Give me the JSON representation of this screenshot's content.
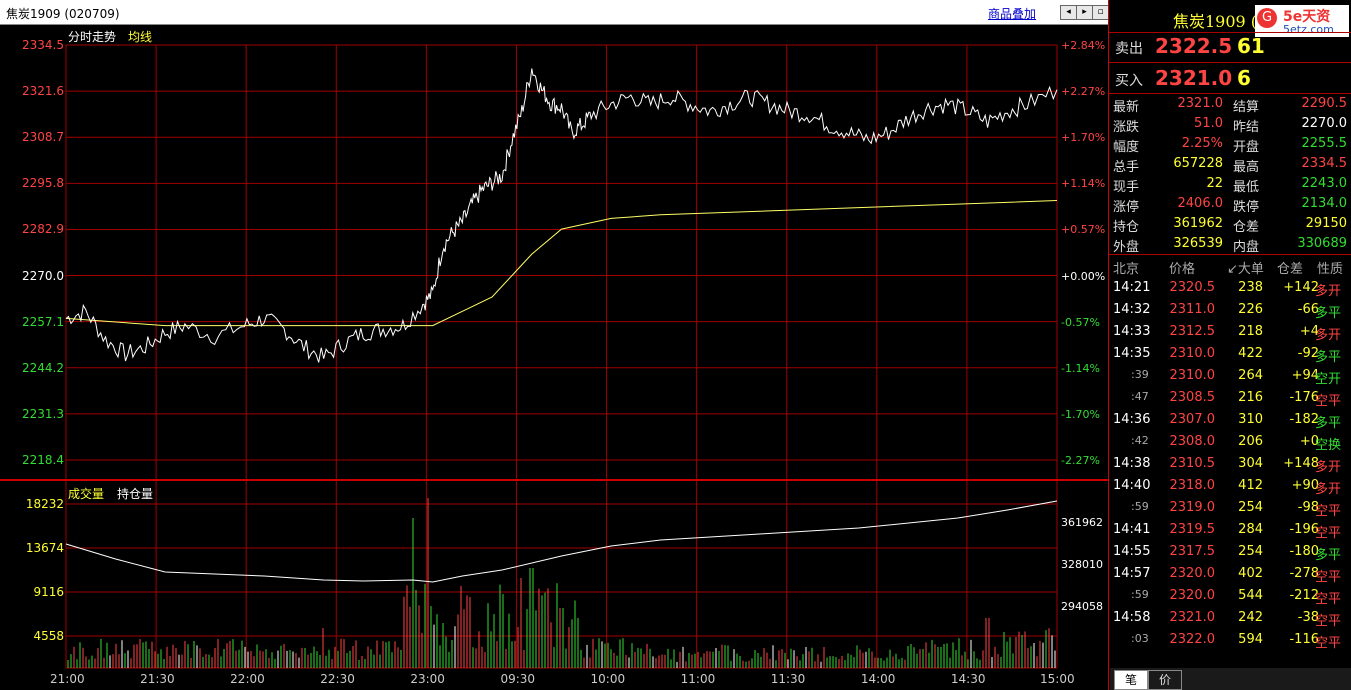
{
  "window": {
    "title": "焦炭1909 (020709)",
    "overlay_link": "商品叠加"
  },
  "price_chart": {
    "tab_label": "分时走势",
    "avg_label": "均线",
    "y_ticks_left": [
      "2334.5",
      "2321.6",
      "2308.7",
      "2295.8",
      "2282.9",
      "2270.0",
      "2257.1",
      "2244.2",
      "2231.3",
      "2218.4"
    ],
    "y_ticks_right": [
      "+2.84%",
      "+2.27%",
      "+1.70%",
      "+1.14%",
      "+0.57%",
      "+0.00%",
      "-0.57%",
      "-1.14%",
      "-1.70%",
      "-2.27%"
    ],
    "colors": {
      "up": "#ff4444",
      "flat": "#ffffff",
      "down": "#33dd33",
      "grid": "#a00000",
      "price": "#ffffff",
      "average": "#ffff66"
    }
  },
  "volume_chart": {
    "label_volume": "成交量",
    "label_oi": "持仓量",
    "y_ticks_left": [
      "18232",
      "13674",
      "9116",
      "4558"
    ],
    "y_ticks_right": [
      "361962",
      "328010",
      "294058"
    ]
  },
  "time_axis": [
    "21:00",
    "21:30",
    "22:00",
    "22:30",
    "23:00",
    "09:30",
    "10:00",
    "11:00",
    "11:30",
    "14:00",
    "14:30",
    "15:00"
  ],
  "chart_data": [
    {
      "type": "line",
      "title": "分时走势",
      "ylim": [
        2218.4,
        2334.5
      ],
      "series": [
        {
          "name": "价格",
          "points": [
            [
              0,
              2258
            ],
            [
              0.02,
              2260
            ],
            [
              0.04,
              2252
            ],
            [
              0.06,
              2248
            ],
            [
              0.08,
              2250
            ],
            [
              0.1,
              2254
            ],
            [
              0.12,
              2256
            ],
            [
              0.15,
              2253
            ],
            [
              0.18,
              2256
            ],
            [
              0.2,
              2258
            ],
            [
              0.22,
              2255
            ],
            [
              0.24,
              2250
            ],
            [
              0.26,
              2247
            ],
            [
              0.28,
              2251
            ],
            [
              0.3,
              2254
            ],
            [
              0.32,
              2255
            ],
            [
              0.34,
              2256
            ],
            [
              0.36,
              2262
            ],
            [
              0.37,
              2265
            ],
            [
              0.38,
              2278
            ],
            [
              0.39,
              2282
            ],
            [
              0.4,
              2285
            ],
            [
              0.41,
              2290
            ],
            [
              0.42,
              2294
            ],
            [
              0.43,
              2296
            ],
            [
              0.44,
              2298
            ],
            [
              0.45,
              2308
            ],
            [
              0.46,
              2316
            ],
            [
              0.47,
              2328
            ],
            [
              0.48,
              2322
            ],
            [
              0.49,
              2318
            ],
            [
              0.5,
              2317
            ],
            [
              0.51,
              2310
            ],
            [
              0.52,
              2312
            ],
            [
              0.53,
              2315
            ],
            [
              0.55,
              2318
            ],
            [
              0.57,
              2320
            ],
            [
              0.59,
              2318
            ],
            [
              0.61,
              2320
            ],
            [
              0.63,
              2318
            ],
            [
              0.65,
              2316
            ],
            [
              0.67,
              2318
            ],
            [
              0.69,
              2320
            ],
            [
              0.71,
              2318
            ],
            [
              0.73,
              2316
            ],
            [
              0.75,
              2315
            ],
            [
              0.77,
              2312
            ],
            [
              0.79,
              2310
            ],
            [
              0.81,
              2308
            ],
            [
              0.83,
              2310
            ],
            [
              0.85,
              2314
            ],
            [
              0.87,
              2317
            ],
            [
              0.89,
              2318
            ],
            [
              0.91,
              2316
            ],
            [
              0.93,
              2313
            ],
            [
              0.95,
              2316
            ],
            [
              0.97,
              2318
            ],
            [
              1.0,
              2322
            ]
          ]
        },
        {
          "name": "均线",
          "points": [
            [
              0,
              2258
            ],
            [
              0.1,
              2256
            ],
            [
              0.2,
              2256
            ],
            [
              0.3,
              2256
            ],
            [
              0.37,
              2256
            ],
            [
              0.4,
              2260
            ],
            [
              0.43,
              2264
            ],
            [
              0.45,
              2270
            ],
            [
              0.47,
              2276
            ],
            [
              0.5,
              2283
            ],
            [
              0.55,
              2286
            ],
            [
              0.6,
              2287
            ],
            [
              0.7,
              2288
            ],
            [
              0.8,
              2289
            ],
            [
              0.9,
              2290
            ],
            [
              1.0,
              2291
            ]
          ]
        }
      ]
    },
    {
      "type": "bar",
      "title": "成交量",
      "ylim": [
        0,
        18232
      ]
    }
  ],
  "quote": {
    "symbol_title": "焦炭1909 (",
    "brand": "5e天资",
    "brand_sub": "5etz.com",
    "sell_label": "卖出",
    "sell_price": "2322.5",
    "sell_vol": "61",
    "buy_label": "买入",
    "buy_price": "2321.0",
    "buy_vol": "6",
    "stats": [
      {
        "l1": "最新",
        "v1": "2321.0",
        "c1": "red",
        "l2": "结算",
        "v2": "2290.5",
        "c2": "red"
      },
      {
        "l1": "涨跌",
        "v1": "51.0",
        "c1": "red",
        "l2": "昨结",
        "v2": "2270.0",
        "c2": "white"
      },
      {
        "l1": "幅度",
        "v1": "2.25%",
        "c1": "red",
        "l2": "开盘",
        "v2": "2255.5",
        "c2": "green"
      },
      {
        "l1": "总手",
        "v1": "657228",
        "c1": "yellow",
        "l2": "最高",
        "v2": "2334.5",
        "c2": "red"
      },
      {
        "l1": "现手",
        "v1": "22",
        "c1": "yellow",
        "l2": "最低",
        "v2": "2243.0",
        "c2": "green"
      },
      {
        "l1": "涨停",
        "v1": "2406.0",
        "c1": "red",
        "l2": "跌停",
        "v2": "2134.0",
        "c2": "green"
      },
      {
        "l1": "持仓",
        "v1": "361962",
        "c1": "yellow",
        "l2": "仓差",
        "v2": "29150",
        "c2": "yellow"
      },
      {
        "l1": "外盘",
        "v1": "326539",
        "c1": "yellow",
        "l2": "内盘",
        "v2": "330689",
        "c2": "green"
      }
    ]
  },
  "ticks": {
    "headers": [
      "北京",
      "价格",
      "↙大单",
      "仓差",
      "性质"
    ],
    "rows": [
      {
        "time": "14:21",
        "price": "2320.5",
        "vol": "238",
        "diff": "+142",
        "nature": "多开",
        "nc": "red"
      },
      {
        "time": "14:32",
        "price": "2311.0",
        "vol": "226",
        "diff": "-66",
        "nature": "多平",
        "nc": "green"
      },
      {
        "time": "14:33",
        "price": "2312.5",
        "vol": "218",
        "diff": "+4",
        "nature": "多开",
        "nc": "red"
      },
      {
        "time": "14:35",
        "price": "2310.0",
        "vol": "422",
        "diff": "-92",
        "nature": "多平",
        "nc": "green"
      },
      {
        "time": ":39",
        "price": "2310.0",
        "vol": "264",
        "diff": "+94",
        "nature": "空开",
        "nc": "green"
      },
      {
        "time": ":47",
        "price": "2308.5",
        "vol": "216",
        "diff": "-176",
        "nature": "空平",
        "nc": "red"
      },
      {
        "time": "14:36",
        "price": "2307.0",
        "vol": "310",
        "diff": "-182",
        "nature": "多平",
        "nc": "green"
      },
      {
        "time": ":42",
        "price": "2308.0",
        "vol": "206",
        "diff": "+0",
        "nature": "空换",
        "nc": "green"
      },
      {
        "time": "14:38",
        "price": "2310.5",
        "vol": "304",
        "diff": "+148",
        "nature": "多开",
        "nc": "red"
      },
      {
        "time": "14:40",
        "price": "2318.0",
        "vol": "412",
        "diff": "+90",
        "nature": "多开",
        "nc": "red"
      },
      {
        "time": ":59",
        "price": "2319.0",
        "vol": "254",
        "diff": "-98",
        "nature": "空平",
        "nc": "red"
      },
      {
        "time": "14:41",
        "price": "2319.5",
        "vol": "284",
        "diff": "-196",
        "nature": "空平",
        "nc": "red"
      },
      {
        "time": "14:55",
        "price": "2317.5",
        "vol": "254",
        "diff": "-180",
        "nature": "多平",
        "nc": "green"
      },
      {
        "time": "14:57",
        "price": "2320.0",
        "vol": "402",
        "diff": "-278",
        "nature": "空平",
        "nc": "red"
      },
      {
        "time": ":59",
        "price": "2320.0",
        "vol": "544",
        "diff": "-212",
        "nature": "空平",
        "nc": "red"
      },
      {
        "time": "14:58",
        "price": "2321.0",
        "vol": "242",
        "diff": "-38",
        "nature": "空平",
        "nc": "red"
      },
      {
        "time": ":03",
        "price": "2322.0",
        "vol": "594",
        "diff": "-116",
        "nature": "空平",
        "nc": "red"
      }
    ]
  },
  "bottom_tabs": [
    "笔",
    "价"
  ]
}
